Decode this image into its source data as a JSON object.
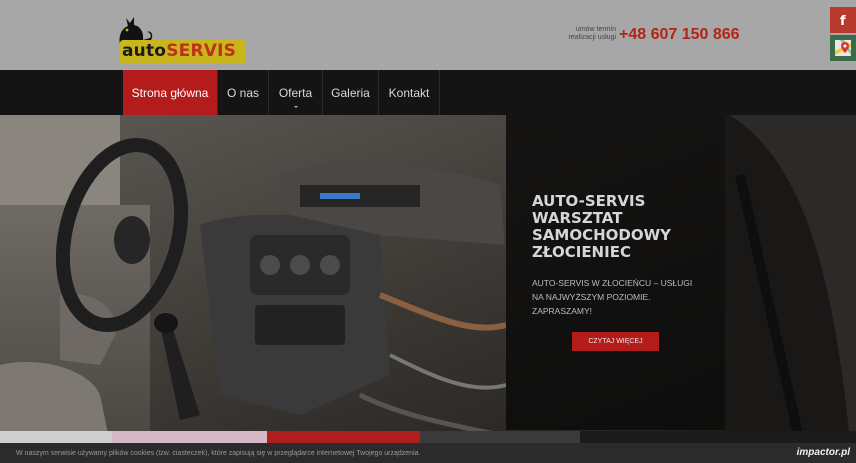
{
  "header": {
    "logo": {
      "word_auto": "auto",
      "word_servis": "SERVIS"
    },
    "contact": {
      "small_line1": "umów termin",
      "small_line2": "realizacji usługi",
      "phone": "+48 607 150 866"
    },
    "social": [
      {
        "name": "facebook",
        "glyph": "f",
        "icon": "facebook-icon",
        "color": "#b73a2d"
      },
      {
        "name": "google-maps",
        "icon": "map-pin-icon",
        "color": "#3b6c4a"
      }
    ]
  },
  "nav": {
    "items": [
      {
        "label": "Strona główna",
        "active": true
      },
      {
        "label": "O nas",
        "active": false
      },
      {
        "label": "Oferta",
        "active": false,
        "has_submenu": true
      },
      {
        "label": "Galeria",
        "active": false
      },
      {
        "label": "Kontakt",
        "active": false
      }
    ]
  },
  "hero": {
    "title_lines": [
      "AUTO-SERVIS",
      "WARSZTAT",
      "SAMOCHODOWY",
      "ZŁOCIENIEC"
    ],
    "text_lines": [
      "AUTO-SERVIS W ZŁOCIEŃCU – USŁUGI",
      "NA NAJWYŻSZYM POZIOMIE.",
      "ZAPRASZAMY!"
    ],
    "button_label": "CZYTAJ WIĘCEJ"
  },
  "cookie": {
    "text": "W naszym serwisie używamy plików cookies (tzw. ciasteczek), które zapisują się w przeglądarce internetowej Twojego urządzenia.",
    "brand": "impactor.pl"
  },
  "colors": {
    "accent": "#b41b1b",
    "phone": "#b52218",
    "header_bg": "#a7a7a7",
    "nav_bg": "#141414",
    "logo_plate": "#c9b51c"
  }
}
